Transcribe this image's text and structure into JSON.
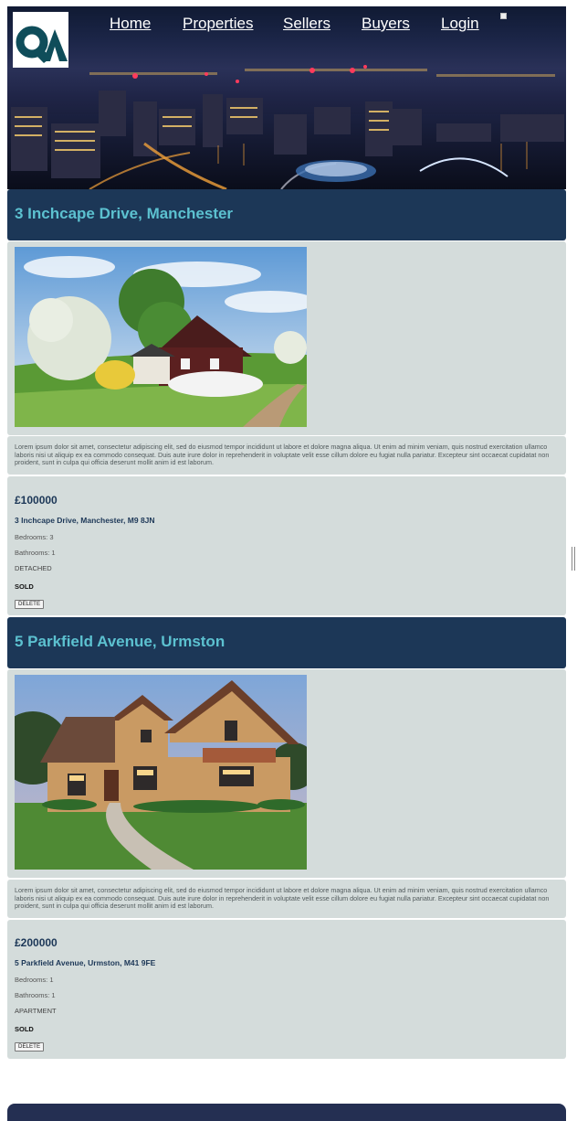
{
  "nav": {
    "items": [
      {
        "label": "Home"
      },
      {
        "label": "Properties"
      },
      {
        "label": "Sellers"
      },
      {
        "label": "Buyers"
      },
      {
        "label": "Login"
      }
    ]
  },
  "listings": [
    {
      "title": "3 Inchcape Drive, Manchester",
      "description": "Lorem ipsum dolor sit amet, consectetur adipiscing elit, sed do eiusmod tempor incididunt ut labore et dolore magna aliqua. Ut enim ad minim veniam, quis nostrud exercitation ullamco laboris nisi ut aliquip ex ea commodo consequat. Duis aute irure dolor in reprehenderit in voluptate velit esse cillum dolore eu fugiat nulla pariatur. Excepteur sint occaecat cupidatat non proident, sunt in culpa qui officia deserunt mollit anim id est laborum.",
      "price": "£100000",
      "address": "3 Inchcape Drive, Manchester, M9 8JN",
      "bedrooms": "Bedrooms: 3",
      "bathrooms": "Bathrooms: 1",
      "type": "DETACHED",
      "status": "SOLD",
      "delete_label": "DELETE"
    },
    {
      "title": "5 Parkfield Avenue, Urmston",
      "description": "Lorem ipsum dolor sit amet, consectetur adipiscing elit, sed do eiusmod tempor incididunt ut labore et dolore magna aliqua. Ut enim ad minim veniam, quis nostrud exercitation ullamco laboris nisi ut aliquip ex ea commodo consequat. Duis aute irure dolor in reprehenderit in voluptate velit esse cillum dolore eu fugiat nulla pariatur. Excepteur sint occaecat cupidatat non proident, sunt in culpa qui officia deserunt mollit anim id est laborum.",
      "price": "£200000",
      "address": "5 Parkfield Avenue, Urmston, M41 9FE",
      "bedrooms": "Bedrooms: 1",
      "bathrooms": "Bathrooms: 1",
      "type": "APARTMENT",
      "status": "SOLD",
      "delete_label": "DELETE"
    }
  ],
  "colors": {
    "title_bar": "#1c3757",
    "title_text": "#5cc1d0",
    "panel": "#d4dcdb",
    "footer": "#242f52"
  }
}
